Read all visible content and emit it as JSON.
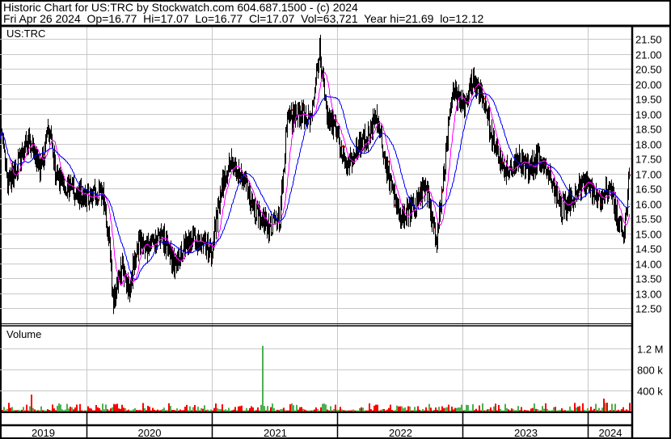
{
  "header": {
    "line1": "Historic Chart for US:TRC by Stockwatch.com 604.687.1500 - (c) 2024",
    "line2": "Fri Apr 26 2024  Op=16.77  Hi=17.07  Lo=16.77  Cl=17.07  Vol=63,721  Year hi=21.69  lo=12.12"
  },
  "colors": {
    "bars": "#000000",
    "close_tick": "#ff0000",
    "ma_short": "#ff00ff",
    "ma_long": "#0000ff",
    "vol_up": "#4caf50",
    "vol_down": "#ff0000",
    "grid": "#c8c8c8"
  },
  "chart_data": {
    "type": "line",
    "title": "US:TRC",
    "volume_title": "Volume",
    "y_ticks": [
      "21.50",
      "21.00",
      "20.50",
      "20.00",
      "19.50",
      "19.00",
      "18.50",
      "18.00",
      "17.50",
      "17.00",
      "16.50",
      "16.00",
      "15.50",
      "15.00",
      "14.50",
      "14.00",
      "13.50",
      "13.00",
      "12.50"
    ],
    "ylim": [
      12.2,
      21.8
    ],
    "volume_ticks": [
      "1.2 M",
      "800 k",
      "400 k"
    ],
    "volume_tick_values": [
      1200000,
      800000,
      400000
    ],
    "x_ticks": [
      "2019",
      "2020",
      "2021",
      "2022",
      "2023",
      "2024"
    ],
    "x_range_years": [
      2019.31,
      2024.34
    ],
    "series": [
      {
        "name": "price",
        "points": [
          [
            2019.32,
            18.2
          ],
          [
            2019.37,
            16.6
          ],
          [
            2019.54,
            18.1
          ],
          [
            2019.63,
            17.1
          ],
          [
            2019.7,
            18.5
          ],
          [
            2019.76,
            16.85
          ],
          [
            2019.89,
            16.45
          ],
          [
            2020.02,
            16.2
          ],
          [
            2020.12,
            16.45
          ],
          [
            2020.18,
            14.7
          ],
          [
            2020.21,
            12.8
          ],
          [
            2020.28,
            13.9
          ],
          [
            2020.34,
            13.1
          ],
          [
            2020.41,
            14.7
          ],
          [
            2020.5,
            14.4
          ],
          [
            2020.6,
            15.0
          ],
          [
            2020.7,
            13.9
          ],
          [
            2020.79,
            14.7
          ],
          [
            2020.92,
            14.7
          ],
          [
            2021.0,
            14.4
          ],
          [
            2021.08,
            16.6
          ],
          [
            2021.15,
            17.4
          ],
          [
            2021.25,
            16.85
          ],
          [
            2021.34,
            15.8
          ],
          [
            2021.44,
            15.2
          ],
          [
            2021.54,
            15.5
          ],
          [
            2021.6,
            18.75
          ],
          [
            2021.7,
            19.0
          ],
          [
            2021.79,
            18.75
          ],
          [
            2021.86,
            21.2
          ],
          [
            2021.92,
            18.75
          ],
          [
            2021.99,
            18.5
          ],
          [
            2022.08,
            17.1
          ],
          [
            2022.15,
            17.9
          ],
          [
            2022.25,
            18.2
          ],
          [
            2022.31,
            19.0
          ],
          [
            2022.41,
            16.85
          ],
          [
            2022.5,
            15.5
          ],
          [
            2022.6,
            15.8
          ],
          [
            2022.7,
            16.6
          ],
          [
            2022.79,
            14.7
          ],
          [
            2022.86,
            17.4
          ],
          [
            2022.92,
            19.8
          ],
          [
            2023.02,
            19.3
          ],
          [
            2023.08,
            20.2
          ],
          [
            2023.18,
            19.3
          ],
          [
            2023.25,
            17.9
          ],
          [
            2023.34,
            17.1
          ],
          [
            2023.44,
            17.5
          ],
          [
            2023.54,
            17.1
          ],
          [
            2023.6,
            17.6
          ],
          [
            2023.7,
            16.85
          ],
          [
            2023.79,
            15.8
          ],
          [
            2023.89,
            16.3
          ],
          [
            2023.99,
            16.85
          ],
          [
            2024.08,
            16.0
          ],
          [
            2024.18,
            16.6
          ],
          [
            2024.25,
            15.2
          ],
          [
            2024.29,
            15.0
          ],
          [
            2024.33,
            17.07
          ]
        ]
      },
      {
        "name": "volume_spike",
        "points": [
          [
            2021.4,
            1250000
          ]
        ]
      }
    ],
    "volume_typical_max": 150000
  }
}
